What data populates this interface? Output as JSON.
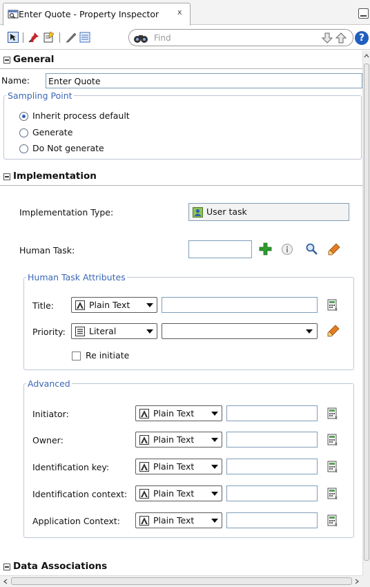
{
  "tab": {
    "title": "Enter Quote - Property Inspector",
    "close": "x"
  },
  "toolbar": {
    "find_placeholder": "Find",
    "help": "?"
  },
  "general": {
    "header": "General",
    "name_label": "Name:",
    "name_value": "Enter Quote",
    "sampling_legend": "Sampling Point",
    "options": [
      "Inherit process default",
      "Generate",
      "Do Not generate"
    ],
    "selected": 0
  },
  "implementation": {
    "header": "Implementation",
    "type_label": "Implementation Type:",
    "type_value": "User task",
    "human_task_label": "Human Task:",
    "attributes": {
      "legend": "Human Task Attributes",
      "title_label": "Title:",
      "title_mode": "Plain Text",
      "priority_label": "Priority:",
      "priority_mode": "Literal",
      "reinitiate_label": "Re initiate"
    },
    "advanced": {
      "legend": "Advanced",
      "rows": [
        {
          "label": "Initiator:",
          "mode": "Plain Text"
        },
        {
          "label": "Owner:",
          "mode": "Plain Text"
        },
        {
          "label": "Identification key:",
          "mode": "Plain Text"
        },
        {
          "label": "Identification context:",
          "mode": "Plain Text"
        },
        {
          "label": "Application Context:",
          "mode": "Plain Text"
        }
      ]
    }
  },
  "data_associations": {
    "header": "Data Associations"
  },
  "colors": {
    "legend": "#3a66b6",
    "add_green": "#2e9b2e",
    "help_blue": "#1f5fbf"
  }
}
